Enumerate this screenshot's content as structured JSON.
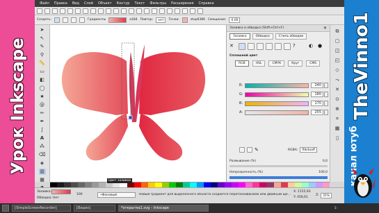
{
  "banners": {
    "left": "Урок Inkscape",
    "right_top": "TheVinno1",
    "right_bottom": "канал ютуб"
  },
  "menu": [
    "Файл",
    "Правка",
    "Вид",
    "Слой",
    "Объект",
    "Контур",
    "Текст",
    "Фильтры",
    "Расширения",
    "Справка"
  ],
  "toolbar2": {
    "create_label": "Создать:",
    "gradients_label": "Градиенты",
    "gradient_name": "a184",
    "repeat_label": "Повтор:",
    "repeat_value": "нет",
    "stops_label": "Точки:",
    "stop_name": "stop6386",
    "offset_label": "Смещение:",
    "offset_value": "0.00"
  },
  "panel": {
    "title": "Заливка и обводка (Shift+Ctrl+F)",
    "tabs": [
      "Заливка",
      "Обводка",
      "Стиль обводки"
    ],
    "fill_type": "Сплошной цвет",
    "modes": [
      "RGB",
      "HSL",
      "CMYK",
      "Круг",
      "CMS"
    ],
    "channels": [
      {
        "label": "R:",
        "value": "240"
      },
      {
        "label": "G:",
        "value": "180"
      },
      {
        "label": "B:",
        "value": "170"
      },
      {
        "label": "A:",
        "value": "255"
      }
    ],
    "rgba_label": "RGBA:",
    "rgba_value": "f0b4aaff",
    "blur_label": "Размывание (%)",
    "blur_value": "0,0",
    "opacity_label": "Непрозрачность (%)",
    "opacity_value": "100,0"
  },
  "status": {
    "fill_label": "Заливка:",
    "stroke_label": "Обводка:",
    "stroke_value": "Нет",
    "opacity_value": "100",
    "layer_value": "•Фоновый",
    "message": "Новый градиент для выделенного объекта создается перетаскиванием или двойным щелчком...",
    "x_label": "X:",
    "x_value": "1155,93",
    "y_label": "Y:",
    "y_value": "456,61",
    "zoom_label": "Z:",
    "zoom_value": "35%",
    "tooltip": "Цвет заливки"
  },
  "taskbar": {
    "items": [
      "[SimpleScreenRecorder]",
      "[Видео]",
      "*открытка1.svg – Inkscape"
    ],
    "clock": "1:"
  },
  "colors": {
    "butterfly_light": "#f4a795",
    "butterfly_dark": "#e2394d",
    "accent_pink": "#ec4d96",
    "accent_blue": "#1b80cf"
  }
}
